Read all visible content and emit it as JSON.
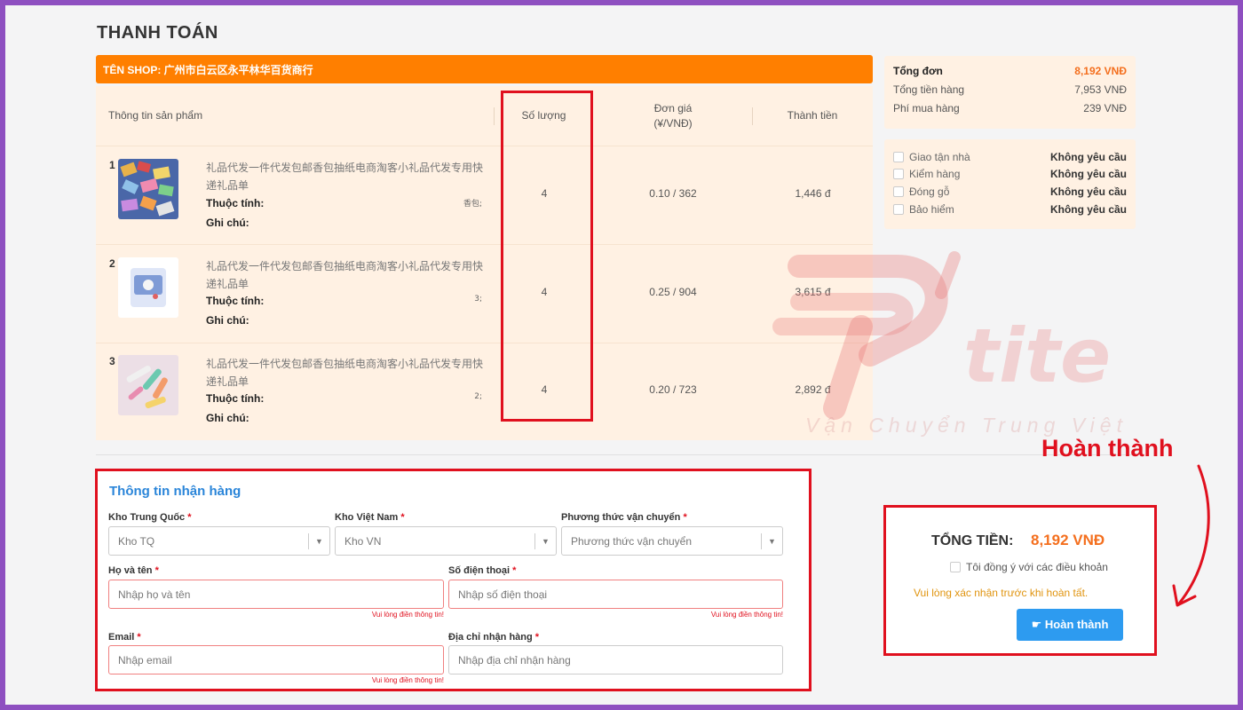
{
  "page_title": "THANH TOÁN",
  "shop_bar": {
    "label": "TÊN SHOP: 广州市白云区永平林华百货商行"
  },
  "table": {
    "headers": {
      "product": "Thông tin sản phẩm",
      "quantity": "Số lượng",
      "unit_price": "Đơn giá",
      "unit_price_sub": "(¥/VNĐ)",
      "amount": "Thành tiền"
    },
    "attr_label": "Thuộc tính:",
    "note_label": "Ghi chú:",
    "rows": [
      {
        "index": "1",
        "name": "礼品代发一件代发包邮香包抽纸电商淘客小礼品代发专用快递礼品单",
        "attr": "香包;",
        "quantity": "4",
        "unit_price": "0.10 / 362",
        "amount": "1,446 đ"
      },
      {
        "index": "2",
        "name": "礼品代发一件代发包邮香包抽纸电商淘客小礼品代发专用快递礼品单",
        "attr": "3;",
        "quantity": "4",
        "unit_price": "0.25 / 904",
        "amount": "3,615 đ"
      },
      {
        "index": "3",
        "name": "礼品代发一件代发包邮香包抽纸电商淘客小礼品代发专用快递礼品单",
        "attr": "2;",
        "quantity": "4",
        "unit_price": "0.20 / 723",
        "amount": "2,892 đ"
      }
    ]
  },
  "summary": {
    "order_total_label": "Tổng đơn",
    "order_total_value": "8,192 VNĐ",
    "goods_total_label": "Tổng tiền hàng",
    "goods_total_value": "7,953 VNĐ",
    "fee_label": "Phí mua hàng",
    "fee_value": "239 VNĐ"
  },
  "services": [
    {
      "label": "Giao tận nhà",
      "value": "Không yêu cầu"
    },
    {
      "label": "Kiểm hàng",
      "value": "Không yêu cầu"
    },
    {
      "label": "Đóng gỗ",
      "value": "Không yêu cầu"
    },
    {
      "label": "Bảo hiểm",
      "value": "Không yêu cầu"
    }
  ],
  "form": {
    "title": "Thông tin nhận hàng",
    "required_mark": "*",
    "error_text": "Vui lòng điền thông tin!",
    "kho_tq": {
      "label": "Kho Trung Quốc",
      "value": "Kho TQ"
    },
    "kho_vn": {
      "label": "Kho Việt Nam",
      "value": "Kho VN"
    },
    "shipping": {
      "label": "Phương thức vận chuyển",
      "value": "Phương thức vận chuyển"
    },
    "name": {
      "label": "Họ và tên",
      "placeholder": "Nhập họ và tên"
    },
    "phone": {
      "label": "Số điện thoại",
      "placeholder": "Nhập số điện thoại"
    },
    "email": {
      "label": "Email",
      "placeholder": "Nhập email"
    },
    "address": {
      "label": "Địa chỉ nhận hàng",
      "placeholder": "Nhập địa chỉ nhận hàng"
    }
  },
  "watermark": {
    "brand": "P'tite",
    "tagline": "Vận Chuyển Trung Việt"
  },
  "annotation": "Hoàn thành",
  "checkout": {
    "total_label": "TỔNG TIỀN:",
    "total_value": "8,192 VNĐ",
    "agree_label": "Tôi đồng ý với các điều khoản",
    "warning": "Vui lòng xác nhận trước khi hoàn tất.",
    "button_label": "Hoàn thành"
  },
  "colors": {
    "accent_orange": "#ff7f00",
    "highlight_red": "#e0101e",
    "link_blue": "#2a85d9",
    "button_blue": "#2d9bf0",
    "frame_purple": "#8e4fc0"
  },
  "icons": {
    "done_button_icon": "pointing-hand-icon",
    "select_caret": "caret-down-icon"
  }
}
